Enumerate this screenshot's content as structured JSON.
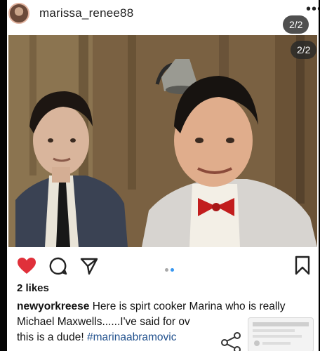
{
  "post": {
    "username": "marissa_renee88",
    "more_icon": "•••",
    "counter_badge_1": "2/2",
    "counter_badge_2": "2/2"
  },
  "photo": {
    "description_icon": "photo-content"
  },
  "actions": {
    "like_icon": "heart-icon",
    "comment_icon": "comment-icon",
    "share_icon": "send-icon",
    "save_icon": "bookmark-icon",
    "carousel_dots": 2,
    "carousel_active": 2
  },
  "likes": "2 likes",
  "caption": {
    "user": "newyorkreese",
    "text_line1": "Here is spirt cooker Marina who is really",
    "text_line2": "Michael Maxwells......I've said for ov",
    "text_line3": "this is a dude!",
    "hashtag": "#marinaabramovic"
  },
  "colors": {
    "heart": "#e0303a",
    "hashtag": "#1f4f8c",
    "dot_active": "#3897f0",
    "dot_inactive": "#a8a8a8"
  }
}
